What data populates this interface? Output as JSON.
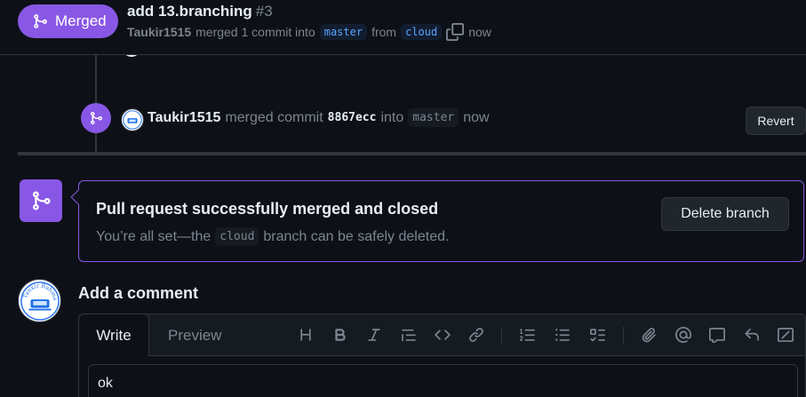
{
  "header": {
    "status_label": "Merged",
    "title": "add 13.branching",
    "number": "#3",
    "author": "Taukir1515",
    "merged_text": "merged 1 commit into",
    "base_branch": "master",
    "from_text": "from",
    "head_branch": "cloud",
    "time": "now"
  },
  "event": {
    "author": "Taukir1515",
    "action": "merged commit",
    "sha": "8867ecc",
    "into_text": "into",
    "branch": "master",
    "time": "now",
    "revert_label": "Revert"
  },
  "merge_box": {
    "title": "Pull request successfully merged and closed",
    "sub_before": "You’re all set—the",
    "branch": "cloud",
    "sub_after": "branch can be safely deleted.",
    "delete_label": "Delete branch"
  },
  "comment": {
    "heading": "Add a comment",
    "write_tab": "Write",
    "preview_tab": "Preview",
    "text": "ok",
    "avatar_text": "Taukir Rahman"
  },
  "toolbar": {
    "icons": [
      "heading-icon",
      "bold-icon",
      "italic-icon",
      "quote-icon",
      "code-icon",
      "link-icon",
      "ordered-list-icon",
      "unordered-list-icon",
      "task-list-icon",
      "attach-icon",
      "mention-icon",
      "reference-icon",
      "reply-icon",
      "slash-command-icon"
    ]
  },
  "colors": {
    "accent_purple": "#8957e5",
    "background": "#0d1117",
    "border": "#30363d",
    "muted_text": "#7d8590",
    "link_blue": "#58a6ff"
  }
}
